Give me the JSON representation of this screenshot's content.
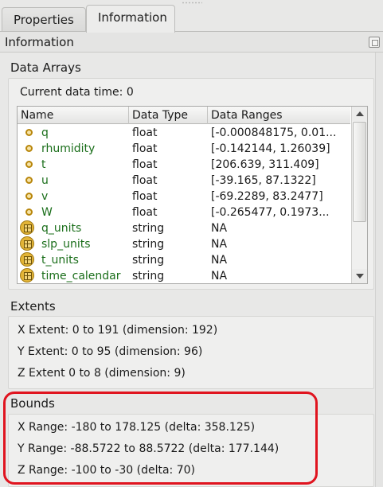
{
  "tabs": [
    {
      "label": "Properties",
      "active": false
    },
    {
      "label": "Information",
      "active": true
    }
  ],
  "panel": {
    "title": "Information"
  },
  "data_arrays": {
    "title": "Data Arrays",
    "current_time_label": "Current data time: 0",
    "columns": [
      "Name",
      "Data Type",
      "Data Ranges"
    ],
    "rows": [
      {
        "icon": "point-data-icon",
        "name": "q",
        "type": "float",
        "range": "[-0.000848175, 0.01..."
      },
      {
        "icon": "point-data-icon",
        "name": "rhumidity",
        "type": "float",
        "range": "[-0.142144, 1.26039]"
      },
      {
        "icon": "point-data-icon",
        "name": "t",
        "type": "float",
        "range": "[206.639, 311.409]"
      },
      {
        "icon": "point-data-icon",
        "name": "u",
        "type": "float",
        "range": "[-39.165, 87.1322]"
      },
      {
        "icon": "point-data-icon",
        "name": "v",
        "type": "float",
        "range": "[-69.2289, 83.2477]"
      },
      {
        "icon": "point-data-icon",
        "name": "W",
        "type": "float",
        "range": "[-0.265477, 0.1973..."
      },
      {
        "icon": "field-data-icon",
        "name": "q_units",
        "type": "string",
        "range": "NA"
      },
      {
        "icon": "field-data-icon",
        "name": "slp_units",
        "type": "string",
        "range": "NA"
      },
      {
        "icon": "field-data-icon",
        "name": "t_units",
        "type": "string",
        "range": "NA"
      },
      {
        "icon": "field-data-icon",
        "name": "time_calendar",
        "type": "string",
        "range": "NA"
      }
    ]
  },
  "extents": {
    "title": "Extents",
    "lines": [
      "X Extent:  0 to 191 (dimension: 192)",
      "Y Extent:  0 to 95 (dimension: 96)",
      "Z Extent   0 to 8 (dimension: 9)"
    ]
  },
  "bounds": {
    "title": "Bounds",
    "lines": [
      "X Range:  -180 to 178.125 (delta: 358.125)",
      "Y Range:  -88.5722 to 88.5722 (delta: 177.144)",
      "Z Range:  -100 to -30 (delta: 70)"
    ]
  },
  "colors": {
    "highlight": "#e0141f",
    "array_name": "#1a6e1a"
  }
}
